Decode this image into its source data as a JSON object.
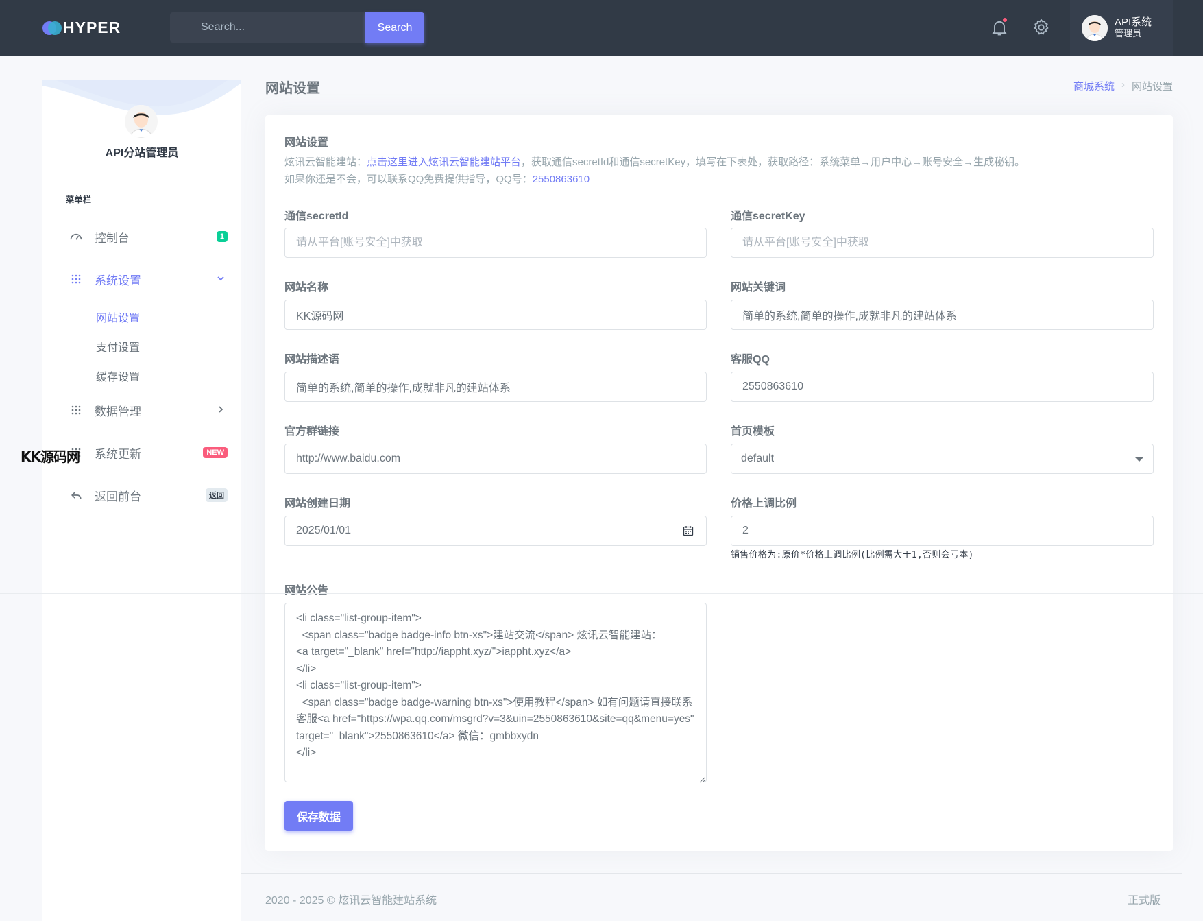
{
  "topbar": {
    "logo_text": "HYPER",
    "search_placeholder": "Search...",
    "search_button": "Search",
    "user_name": "API系统",
    "user_role": "管理员",
    "notification_icon": "bell-icon",
    "settings_icon": "gear-icon"
  },
  "sidebar": {
    "user_name": "API分站管理员",
    "menu_title": "菜单栏",
    "items": [
      {
        "label": "控制台",
        "icon": "dashboard-icon",
        "badge": "1"
      },
      {
        "label": "系统设置",
        "icon": "grid-icon"
      },
      {
        "label": "数据管理",
        "icon": "grid-icon"
      },
      {
        "label": "系统更新",
        "icon": "grid-icon",
        "badge": "NEW"
      },
      {
        "label": "返回前台",
        "icon": "reply-icon",
        "badge": "返回"
      }
    ],
    "sub_items": [
      "网站设置",
      "支付设置",
      "缓存设置"
    ],
    "watermark": "KK源码网"
  },
  "page": {
    "title": "网站设置",
    "breadcrumb": [
      "商城系统",
      "网站设置"
    ]
  },
  "card": {
    "title": "网站设置",
    "desc1_prefix": "炫讯云智能建站：",
    "desc1_link": "点击这里进入炫讯云智能建站平台",
    "desc1_suffix": "，获取通信secretId和通信secretKey，填写在下表处，获取路径：系统菜单→用户中心→账号安全→生成秘钥。",
    "desc2_prefix": "如果你还是不会，可以联系QQ免费提供指导，QQ号：",
    "desc2_qq": "2550863610",
    "fields": {
      "secret_id": {
        "label": "通信secretId",
        "placeholder": "请从平台[账号安全]中获取",
        "value": ""
      },
      "secret_key": {
        "label": "通信secretKey",
        "placeholder": "请从平台[账号安全]中获取",
        "value": ""
      },
      "site_name": {
        "label": "网站名称",
        "value": "KK源码网"
      },
      "site_keywords": {
        "label": "网站关键词",
        "value": "简单的系统,简单的操作,成就非凡的建站体系"
      },
      "site_desc": {
        "label": "网站描述语",
        "value": "简单的系统,简单的操作,成就非凡的建站体系"
      },
      "service_qq": {
        "label": "客服QQ",
        "value": "2550863610"
      },
      "group_link": {
        "label": "官方群链接",
        "value": "http://www.baidu.com"
      },
      "home_template": {
        "label": "首页模板",
        "value": "default"
      },
      "create_date": {
        "label": "网站创建日期",
        "value": "2025/01/01"
      },
      "price_ratio": {
        "label": "价格上调比例",
        "value": "2",
        "help": "销售价格为:原价*价格上调比例(比例需大于1,否则会亏本)"
      },
      "notice": {
        "label": "网站公告",
        "value": "<li class=\"list-group-item\">\n  <span class=\"badge badge-info btn-xs\">建站交流</span> 炫讯云智能建站：\n<a target=\"_blank\" href=\"http://iappht.xyz/\">iappht.xyz</a>\n</li>\n<li class=\"list-group-item\">\n  <span class=\"badge badge-warning btn-xs\">使用教程</span> 如有问题请直接联系客服<a href=\"https://wpa.qq.com/msgrd?v=3&uin=2550863610&site=qq&menu=yes\" target=\"_blank\">2550863610</a> 微信：gmbbxydn\n</li>"
      }
    },
    "save_button": "保存数据"
  },
  "footer": {
    "left": "2020 - 2025 © 炫讯云智能建站系统",
    "right": "正式版"
  },
  "colors": {
    "topbar": "#313a46",
    "primary": "#727cf5",
    "success": "#0acf97",
    "danger": "#fa5c7c"
  }
}
